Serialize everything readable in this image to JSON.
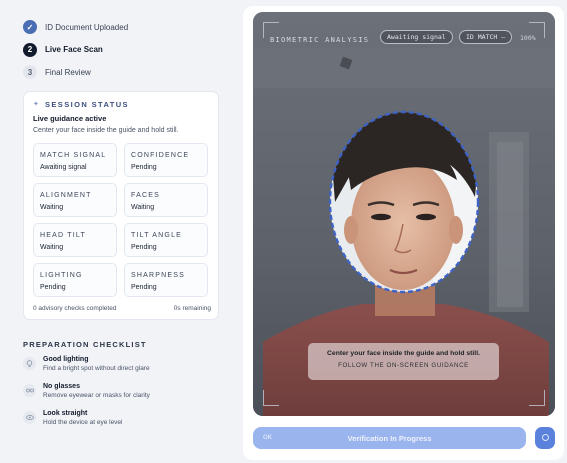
{
  "steps": [
    {
      "label": "ID Document Uploaded",
      "marker": "✓",
      "state": "done"
    },
    {
      "label": "Live Face Scan",
      "marker": "2",
      "state": "active"
    },
    {
      "label": "Final Review",
      "marker": "3",
      "state": "pending"
    }
  ],
  "session": {
    "title": "SESSION STATUS",
    "icon": "sparkle-icon",
    "guidance_title": "Live guidance active",
    "guidance_sub": "Center your face inside the guide and hold still.",
    "metrics": [
      {
        "label": "MATCH SIGNAL",
        "value": "Awaiting signal"
      },
      {
        "label": "CONFIDENCE",
        "value": "Pending"
      },
      {
        "label": "ALIGNMENT",
        "value": "Waiting"
      },
      {
        "label": "FACES",
        "value": "Waiting"
      },
      {
        "label": "HEAD TILT",
        "value": "Waiting"
      },
      {
        "label": "TILT ANGLE",
        "value": "Pending"
      },
      {
        "label": "LIGHTING",
        "value": "Pending"
      },
      {
        "label": "SHARPNESS",
        "value": "Pending"
      }
    ],
    "advisory": "0 advisory checks completed",
    "remaining": "0s remaining"
  },
  "checklist": {
    "title": "PREPARATION CHECKLIST",
    "items": [
      {
        "title": "Good lighting",
        "sub": "Find a bright spot without direct glare",
        "icon": "bulb-icon"
      },
      {
        "title": "No glasses",
        "sub": "Remove eyewear or masks for clarity",
        "icon": "glasses-icon"
      },
      {
        "title": "Look straight",
        "sub": "Hold the device at eye level",
        "icon": "eye-icon"
      }
    ]
  },
  "camera": {
    "label": "BIOMETRIC ANALYSIS",
    "signal_pill": "Awaiting signal",
    "id_match_pill": "ID MATCH —",
    "percent": "100%",
    "guidance_main": "Center your face inside the guide and hold still.",
    "guidance_sub": "FOLLOW THE ON-SCREEN GUIDANCE"
  },
  "actions": {
    "verify_label": "Verification In Progress",
    "verify_small": "OK",
    "round_icon": "camera-switch-icon"
  },
  "colors": {
    "accent": "#4a6eb3",
    "button": "#9ab4ee",
    "oval": "#3e63c4"
  }
}
